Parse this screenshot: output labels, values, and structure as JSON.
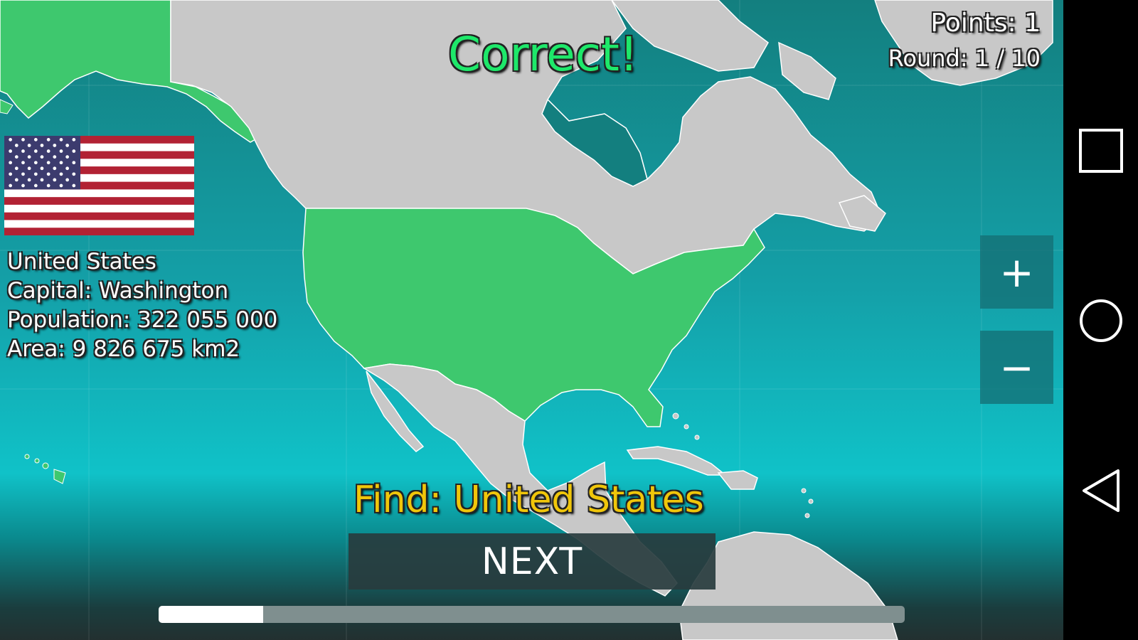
{
  "hud": {
    "points": "Points: 1",
    "round": "Round: 1 / 10",
    "result": "Correct!",
    "find": "Find: United States"
  },
  "country": {
    "name": "United States",
    "capital": "Capital: Washington",
    "population": "Population: 322 055 000",
    "area": "Area: 9 826 675 km2",
    "flag_icon": "us-flag-icon"
  },
  "controls": {
    "zoom_in": "+",
    "zoom_out": "−",
    "next_label": "NEXT"
  },
  "progress": {
    "fraction": 0.14
  },
  "colors": {
    "land": "#c8c8c8",
    "highlight": "#3ec86e",
    "result_text": "#1ee86a",
    "find_text": "#f0c60a"
  },
  "navbar": {
    "icons": [
      "recents-square-icon",
      "home-circle-icon",
      "back-triangle-icon"
    ]
  }
}
